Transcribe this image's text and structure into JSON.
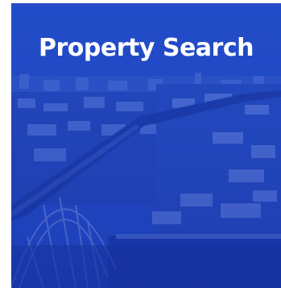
{
  "card": {
    "title": "Property Search",
    "background_image": "city-bridge-photo",
    "overlay_color": "#1e46c8"
  }
}
